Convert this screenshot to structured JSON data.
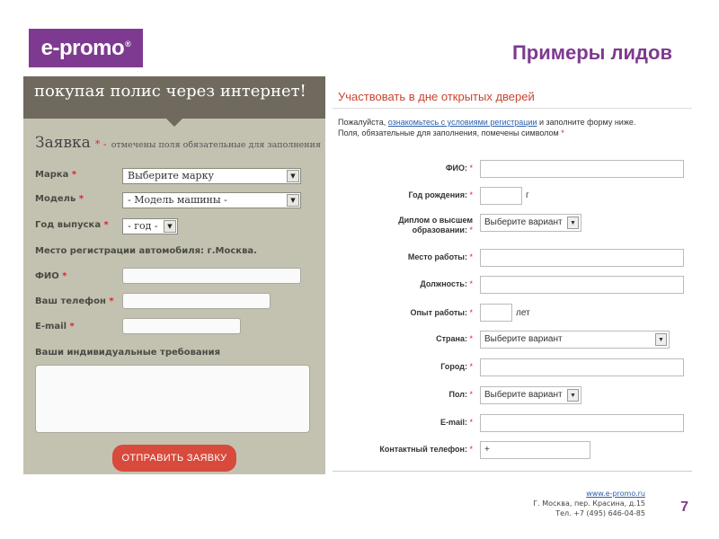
{
  "header": {
    "logo_text": "e-promo",
    "logo_mark": "®",
    "title": "Примеры лидов",
    "accent_color": "#7e3a90"
  },
  "left_form": {
    "banner_text": "покупая полис через интернет!",
    "heading": "Заявка",
    "heading_req": "* -",
    "heading_note": "отмечены поля обязательные для заполнения",
    "brand_label": "Марка",
    "brand_value": "Выберите марку",
    "model_label": "Модель",
    "model_value": "- Модель машины -",
    "year_label": "Год выпуска",
    "year_value": "- год -",
    "registration_text": "Место регистрации автомобиля: г.Москва.",
    "name_label": "ФИО",
    "phone_label": "Ваш телефон",
    "email_label": "E-mail",
    "requirements_label": "Ваши индивидуальные требования",
    "submit_label": "ОТПРАВИТЬ ЗАЯВКУ",
    "required_mark": "*"
  },
  "right_form": {
    "title": "Участвовать в дне открытых дверей",
    "intro_before_link": "Пожалуйста,",
    "intro_link": "ознакомьтесь с условиями регистрации",
    "intro_after_link": "и заполните форму ниже.",
    "intro_line2": "Поля, обязательные для заполнения, помечены символом",
    "required_mark": "*",
    "fields": {
      "fio_label": "ФИО:",
      "birth_year_label": "Год рождения:",
      "birth_year_unit": "г",
      "diploma_label": "Диплом о высшем образовании:",
      "diploma_value": "Выберите вариант",
      "workplace_label": "Место работы:",
      "position_label": "Должность:",
      "experience_label": "Опыт работы:",
      "experience_unit": "лет",
      "country_label": "Страна:",
      "country_value": "Выберите вариант",
      "city_label": "Город:",
      "gender_label": "Пол:",
      "gender_value": "Выберите вариант",
      "email_label": "E-mail:",
      "phone_label": "Контактный телефон:",
      "phone_value": "+"
    }
  },
  "footer": {
    "website": "www.e-promo.ru",
    "address": "Г. Москва, пер. Красина, д.15",
    "phone": "Тел. +7 (495) 646-04-85",
    "page_number": "7"
  }
}
